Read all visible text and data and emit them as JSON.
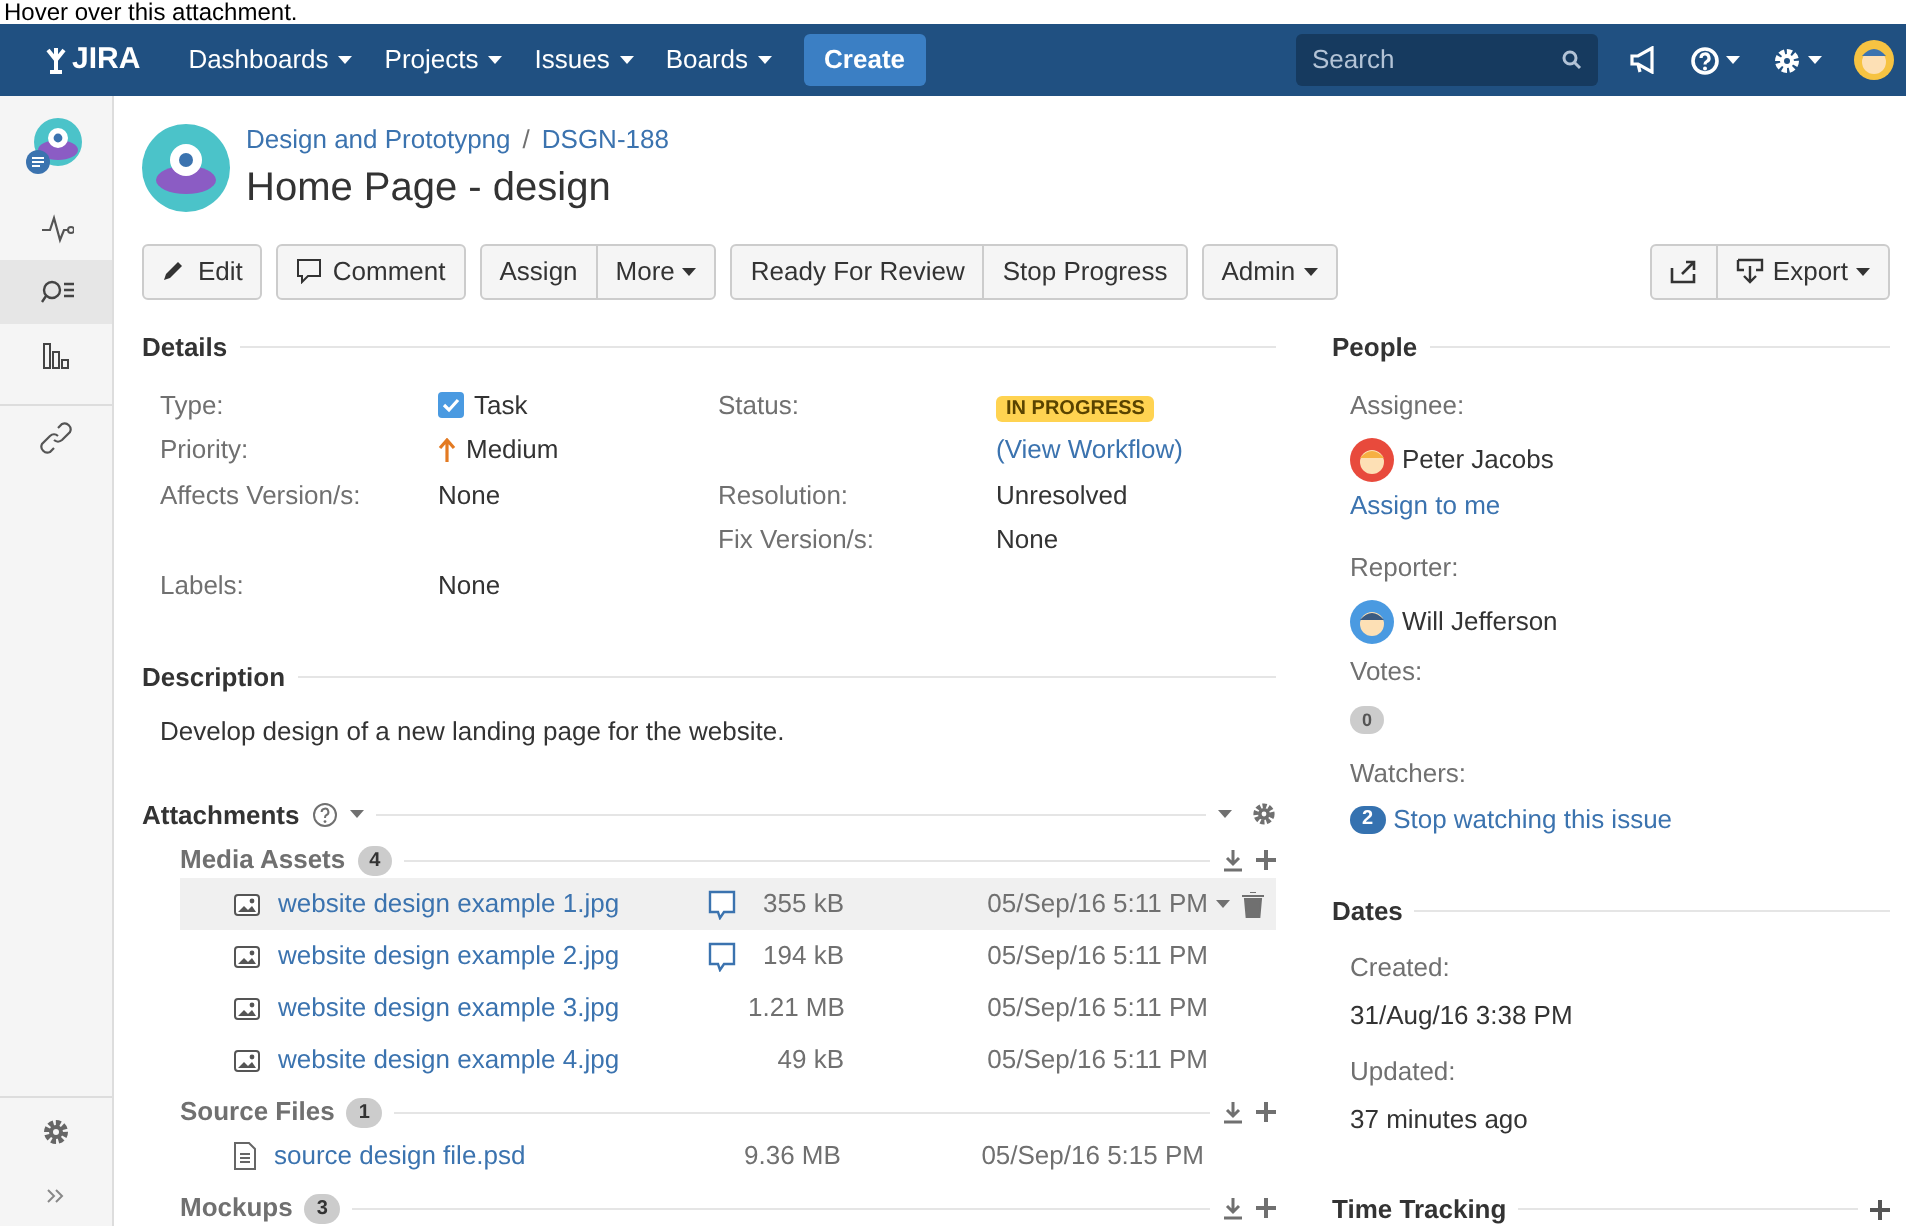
{
  "hint": "Hover over this attachment.",
  "nav": {
    "logo": "JIRA",
    "menus": [
      {
        "label": "Dashboards"
      },
      {
        "label": "Projects"
      },
      {
        "label": "Issues"
      },
      {
        "label": "Boards"
      }
    ],
    "create": "Create",
    "search": {
      "placeholder": "Search"
    }
  },
  "sidebar": {
    "items": [
      {
        "kind": "activity",
        "selected": false
      },
      {
        "kind": "issues",
        "selected": true
      },
      {
        "kind": "reports",
        "selected": false
      },
      {
        "kind": "link",
        "selected": false
      }
    ]
  },
  "issue": {
    "breadcrumbs": [
      "Design and Prototypng",
      "DSGN-188"
    ],
    "separator": "/",
    "title": "Home Page - design"
  },
  "toolbar": {
    "groups": [
      [
        {
          "label": "Edit",
          "dropdown": false
        }
      ],
      [
        {
          "label": "Comment",
          "dropdown": false
        }
      ],
      [
        {
          "label": "Assign",
          "dropdown": false
        },
        {
          "label": "More",
          "dropdown": true
        }
      ],
      [
        {
          "label": "Ready For Review",
          "dropdown": false
        },
        {
          "label": "Stop Progress",
          "dropdown": false
        }
      ],
      [
        {
          "label": "Admin",
          "dropdown": true
        }
      ]
    ],
    "right": [
      {
        "dropdown": false
      },
      {
        "label": "Export",
        "dropdown": true
      }
    ]
  },
  "details": {
    "title": "Details",
    "rows": [
      {
        "left": {
          "label": "Type:",
          "value": "Task",
          "kind": "type"
        },
        "right": {
          "label": "Status:",
          "value": "IN PROGRESS",
          "kind": "status"
        }
      },
      {
        "left": {
          "label": "Priority:",
          "value": "Medium",
          "kind": "priority"
        },
        "right": {
          "value": "(View Workflow)",
          "kind": "link"
        }
      },
      {
        "left": {
          "label": "Affects Version/s:",
          "value": "None",
          "kind": "text"
        },
        "right": {
          "label": "Resolution:",
          "value": "Unresolved",
          "kind": "text"
        }
      },
      {
        "right": {
          "label": "Fix Version/s:",
          "value": "None",
          "kind": "text"
        }
      },
      {
        "left": {
          "label": "Labels:",
          "value": "None",
          "kind": "text"
        }
      }
    ]
  },
  "description": {
    "title": "Description",
    "text": "Develop design of a new landing page for the website."
  },
  "attachments": {
    "title": "Attachments",
    "groups": [
      {
        "name": "Media Assets",
        "count": "4",
        "files": [
          {
            "name": "website design example 1.jpg",
            "kind": "image",
            "comments": true,
            "hovered": true,
            "size": "355 kB",
            "date": "05/Sep/16 5:11 PM"
          },
          {
            "name": "website design example 2.jpg",
            "kind": "image",
            "comments": true,
            "hovered": false,
            "size": "194 kB",
            "date": "05/Sep/16 5:11 PM"
          },
          {
            "name": "website design example 3.jpg",
            "kind": "image",
            "comments": false,
            "hovered": false,
            "size": "1.21 MB",
            "date": "05/Sep/16 5:11 PM"
          },
          {
            "name": "website design example 4.jpg",
            "kind": "image",
            "comments": false,
            "hovered": false,
            "size": "49 kB",
            "date": "05/Sep/16 5:11 PM"
          }
        ]
      },
      {
        "name": "Source Files",
        "count": "1",
        "files": [
          {
            "name": "source design file.psd",
            "kind": "document",
            "comments": false,
            "hovered": false,
            "size": "9.36 MB",
            "date": "05/Sep/16 5:15 PM"
          }
        ]
      },
      {
        "name": "Mockups",
        "count": "3"
      }
    ]
  },
  "people": {
    "title": "People",
    "assignee": {
      "label": "Assignee:",
      "name": "Peter Jacobs",
      "action": "Assign to me"
    },
    "reporter": {
      "label": "Reporter:",
      "name": "Will Jefferson"
    },
    "votes": {
      "label": "Votes:",
      "count": "0"
    },
    "watchers": {
      "label": "Watchers:",
      "count": "2",
      "action": "Stop watching this issue"
    }
  },
  "dates": {
    "title": "Dates",
    "items": [
      {
        "label": "Created:",
        "value": "31/Aug/16 3:38 PM"
      },
      {
        "label": "Updated:",
        "value": "37 minutes ago"
      }
    ]
  },
  "time_tracking": {
    "title": "Time Tracking"
  }
}
